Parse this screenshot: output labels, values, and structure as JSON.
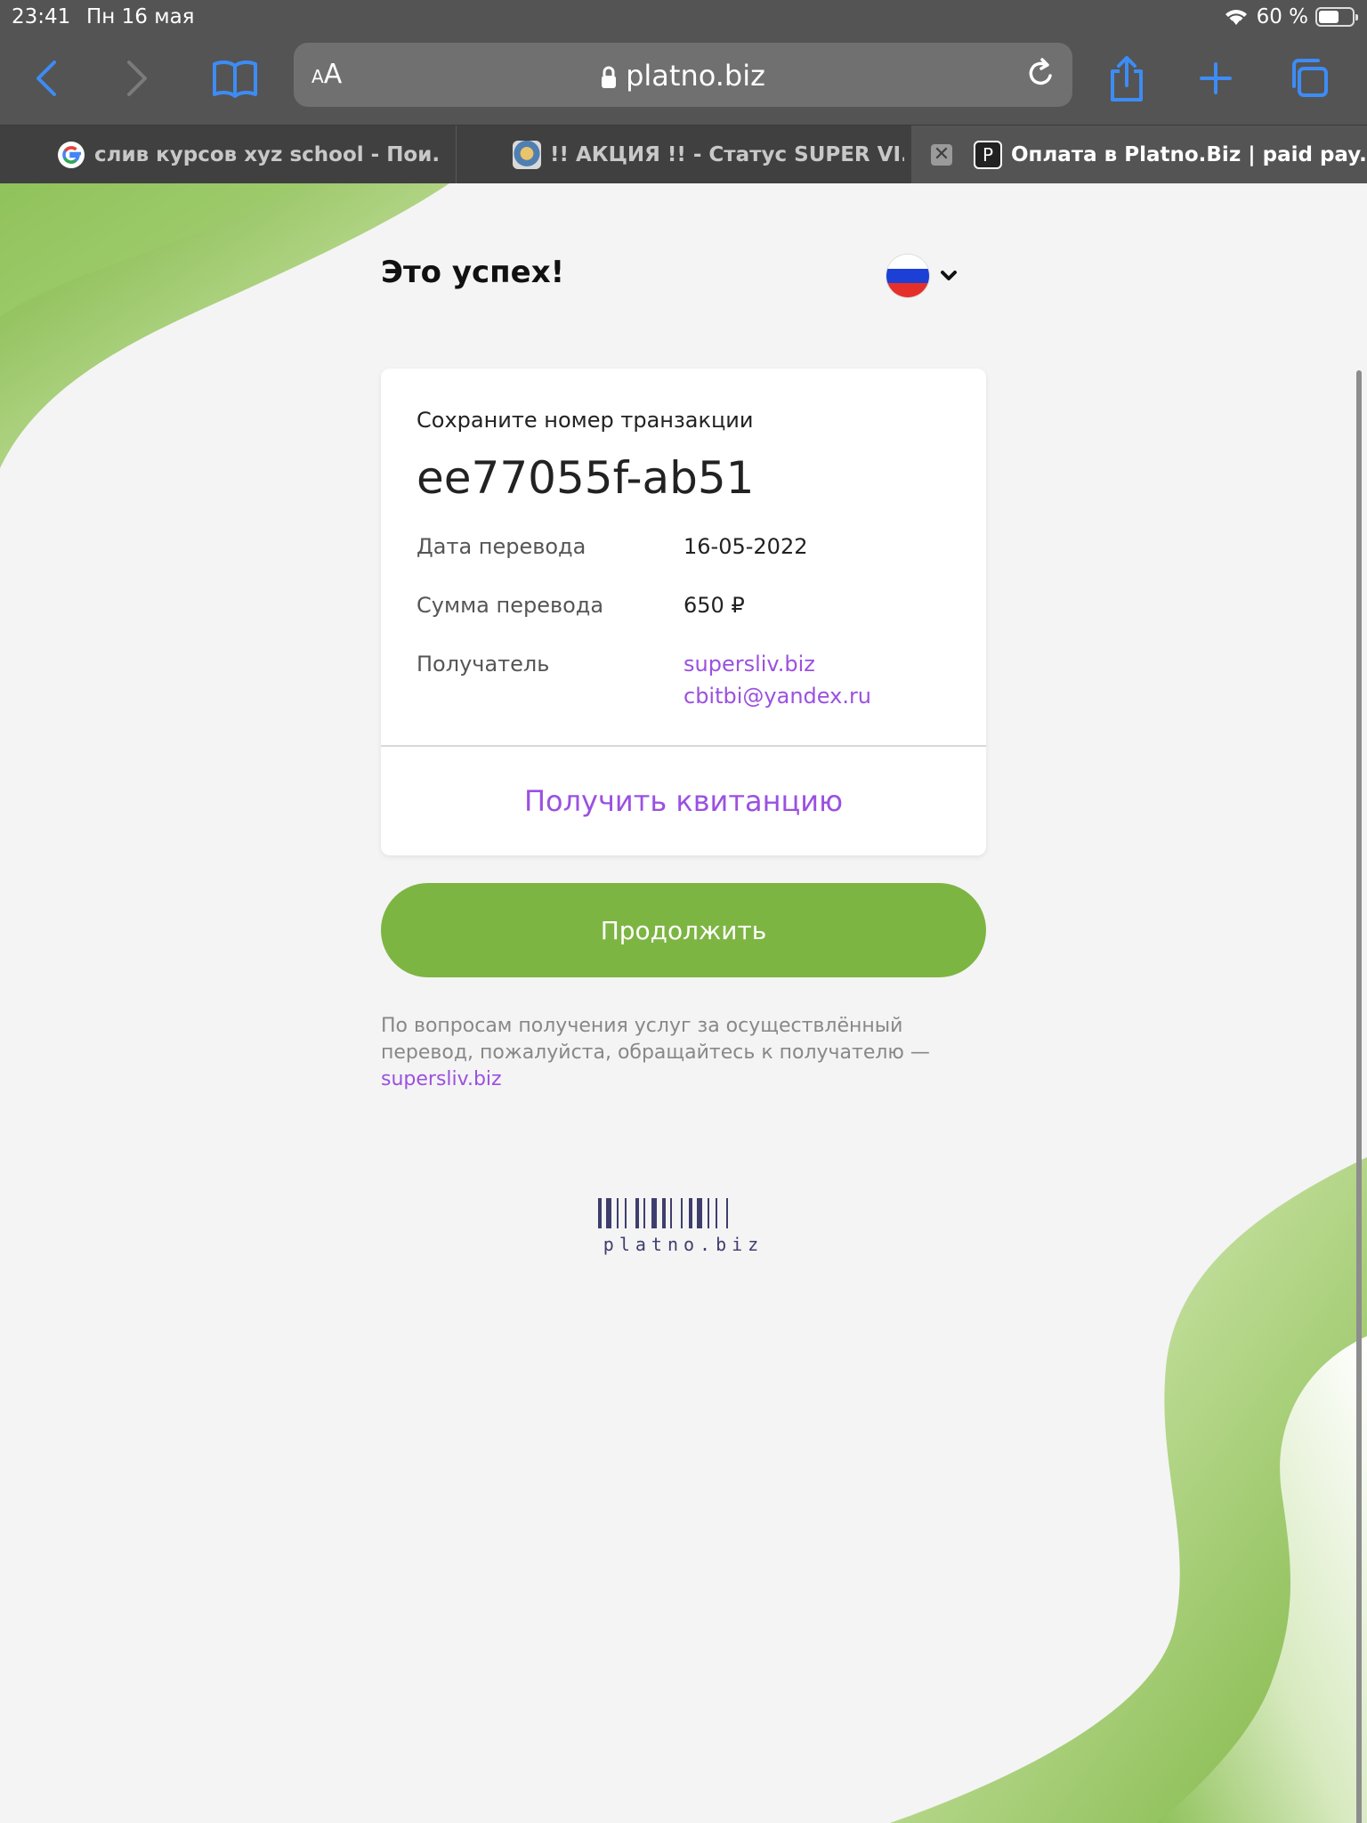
{
  "status_bar": {
    "time": "23:41",
    "date": "Пн 16 мая",
    "battery": "60 %",
    "battery_level": 0.6
  },
  "browser": {
    "address_text_size": "AA",
    "url_host": "platno.biz",
    "tabs": [
      {
        "title": "слив курсов xyz school - Пои..."
      },
      {
        "title": "!! АКЦИЯ !! - Статус SUPER VI..."
      },
      {
        "title": "Оплата в Platno.Biz | paid pay...",
        "favicon_letter": "P",
        "active": true
      }
    ]
  },
  "page": {
    "title": "Это успех!",
    "language": "ru-flag-icon",
    "card": {
      "save_label": "Сохраните номер транзакции",
      "transaction_id": "ee77055f-ab51",
      "rows": [
        {
          "label": "Дата перевода",
          "value": "16-05-2022"
        },
        {
          "label": "Сумма перевода",
          "value": "650 ₽"
        },
        {
          "label": "Получатель",
          "value": "supersliv.biz",
          "value2": "cbitbi@yandex.ru"
        }
      ],
      "receipt_button": "Получить квитанцию"
    },
    "continue_button": "Продолжить",
    "note_text": "По вопросам получения услуг за осуществлённый перевод, пожалуйста, обращайтесь к получателю —",
    "note_link": "supersliv.biz",
    "footer_logo": "platno.biz"
  },
  "colors": {
    "accent_purple": "#9b51e0",
    "brand_green": "#7db543",
    "chrome_gray": "#545454",
    "tab_bar": "#404040"
  }
}
